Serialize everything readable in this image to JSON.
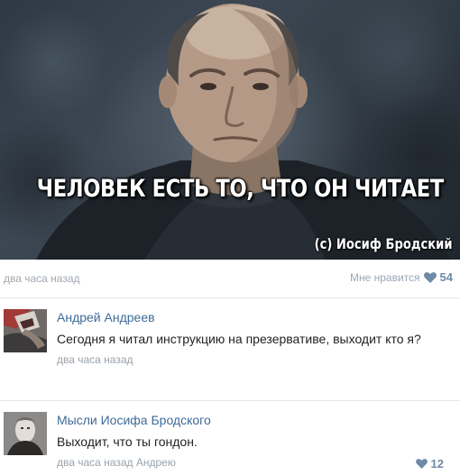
{
  "post": {
    "image": {
      "headline": "ЧЕЛОВЕК ЕСТЬ ТО, ЧТО ОН ЧИТАЕТ",
      "caption": "(с) Иосиф Бродский"
    },
    "time": "два часа назад",
    "like_label": "Мне нравится",
    "likes": "54",
    "accent_color": "#6f8aa6"
  },
  "comments": [
    {
      "author": "Андрей Андреев",
      "text": "Сегодня я читал инструкцию на презервативе, выходит кто я?",
      "time": "два часа назад"
    },
    {
      "author": "Мысли Иосифа Бродского",
      "text": "Выходит, что ты гондон.",
      "time": "два часа назад",
      "reply_to": "Андрею",
      "likes": "12"
    }
  ],
  "icons": {
    "like": "heart-icon"
  }
}
